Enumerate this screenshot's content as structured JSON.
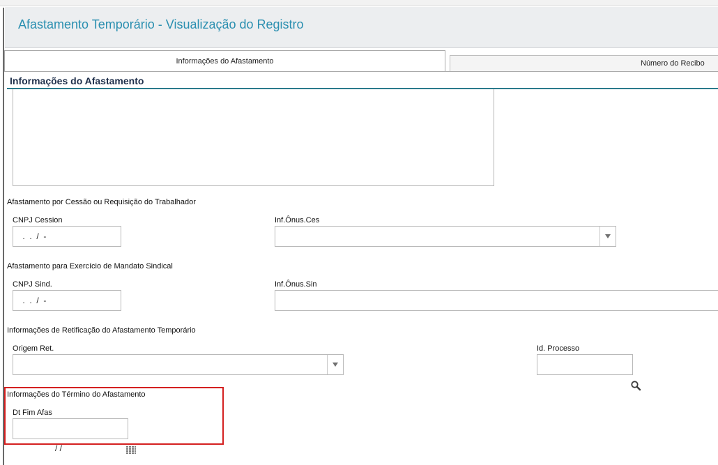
{
  "page": {
    "title": "Afastamento Temporário - Visualização do Registro"
  },
  "tabs": [
    {
      "label": "Informações do Afastamento",
      "active": true
    },
    {
      "label": "Número do Recibo",
      "active": false
    }
  ],
  "section": {
    "title": "Informações do Afastamento"
  },
  "cessao": {
    "title": "Afastamento por Cessão ou Requisição do Trabalhador",
    "cnpj_label": "CNPJ Cession",
    "cnpj_value": " .  .  /  -",
    "onus_label": "Inf.Ônus.Ces",
    "onus_value": ""
  },
  "sindical": {
    "title": "Afastamento para Exercício de Mandato Sindical",
    "cnpj_label": "CNPJ Sind.",
    "cnpj_value": " .  .  /  -",
    "onus_label": "Inf.Ônus.Sin",
    "onus_value": ""
  },
  "retificacao": {
    "title": "Informações de Retificação do Afastamento Temporário",
    "origem_label": "Origem Ret.",
    "origem_value": "",
    "processo_label": "Id. Processo",
    "processo_value": ""
  },
  "termino": {
    "title": "Informações do Término do Afastamento",
    "dt_label": "Dt Fim Afas",
    "dt_value": "           / /"
  },
  "icons": {
    "dropdown": "chevron-down-icon",
    "search": "search-icon",
    "calendar": "calendar-icon"
  },
  "colors": {
    "title": "#2a8fb0",
    "section_rule": "#2a7a8c",
    "highlight": "#d42020"
  }
}
